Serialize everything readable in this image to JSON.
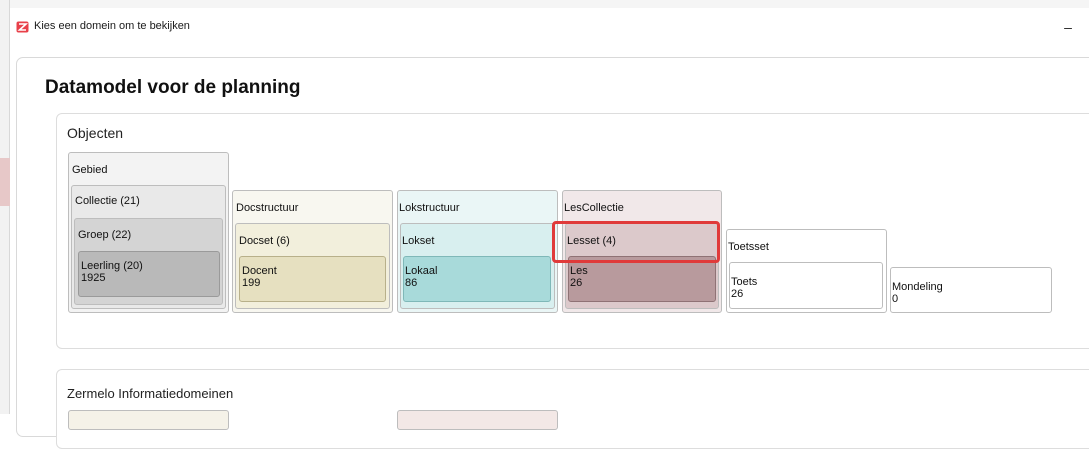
{
  "window": {
    "title": "Kies een domein om te bekijken",
    "minimize_label": "–"
  },
  "page": {
    "title": "Datamodel voor de planning"
  },
  "objecten": {
    "title": "Objecten",
    "gebied": "Gebied",
    "collectie": "Collectie (21)",
    "groep": "Groep (22)",
    "leerling": {
      "label": "Leerling (20)",
      "count": "1925"
    },
    "docstructuur": "Docstructuur",
    "docset": "Docset (6)",
    "docent": {
      "label": "Docent",
      "count": "199"
    },
    "lokstructuur": "Lokstructuur",
    "lokset": "Lokset",
    "lokaal": {
      "label": "Lokaal",
      "count": "86"
    },
    "lescollectie": "LesCollectie",
    "lesset": "Lesset (4)",
    "les": {
      "label": "Les",
      "count": "26"
    },
    "toetsset": "Toetsset",
    "toets": {
      "label": "Toets",
      "count": "26"
    },
    "mondeling": {
      "label": "Mondeling",
      "count": "0"
    }
  },
  "domains": {
    "title": "Zermelo Informatiedomeinen"
  }
}
